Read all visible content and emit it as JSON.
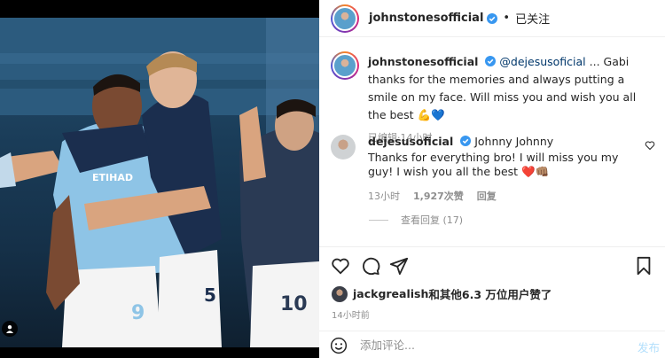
{
  "post": {
    "author": "johnstonesofficial",
    "follow_status": "已关注",
    "more_label": "•••"
  },
  "caption": {
    "author": "johnstonesofficial",
    "mention": "@dejesusoficial",
    "text": " ... Gabi thanks for the memories and always putting a smile on my face. Will miss you and wish you all the best ",
    "emoji": "💪💙",
    "edited": "已编辑",
    "time": "14小时"
  },
  "comment": {
    "author": "dejesusoficial",
    "first_line": "Johnny Johnny",
    "text": "Thanks for everything bro! I will miss you my guy! I wish you all the best ",
    "emoji": "❤️👊🏽",
    "time": "13小时",
    "likes": "1,927次赞",
    "reply": "回复",
    "view_replies": "查看回复 (17)"
  },
  "likes": {
    "user": "jackgrealish",
    "rest": "和其他6.3 万位用户赞了"
  },
  "timestamp": "14小时前",
  "composer": {
    "placeholder": "添加评论...",
    "post_label": "发布"
  },
  "colors": {
    "verified": "#3897f0",
    "mention": "#00376b",
    "post_button": "#b2dffc",
    "muted": "#8e8e8e",
    "jersey_home": "#8ec4e6",
    "training_top": "#1b2e4e"
  },
  "photo": {
    "jersey_numbers": [
      "9",
      "5",
      "10"
    ],
    "sponsor": "ETIHAD"
  }
}
